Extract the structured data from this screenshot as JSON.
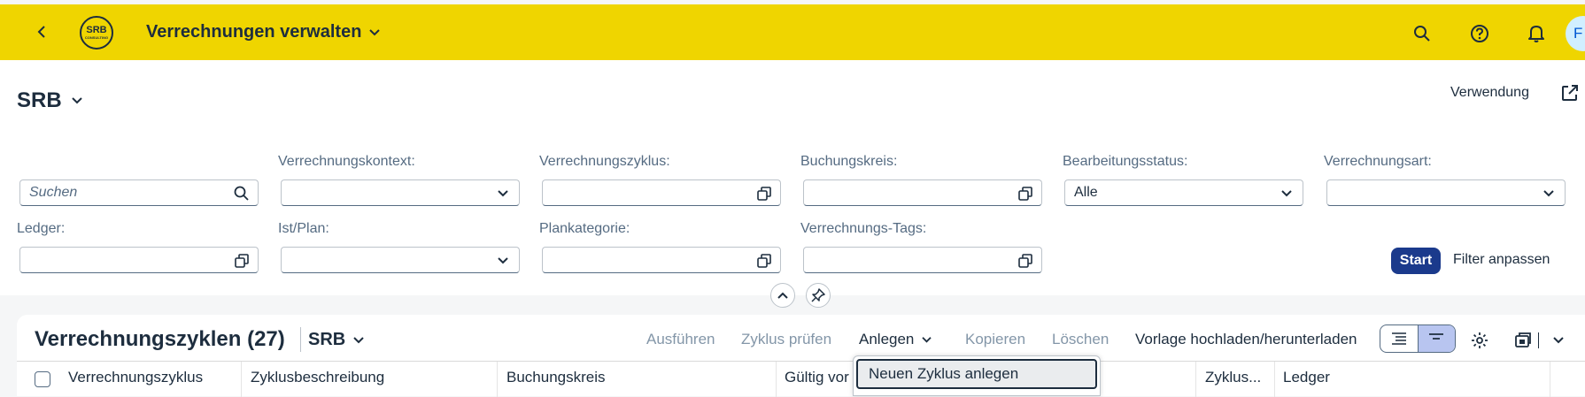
{
  "shell": {
    "title": "Verrechnungen verwalten",
    "logo_text": "SRB",
    "logo_subtext": "CONSULTING",
    "avatar_initial": "F",
    "brand_color": "#efd500"
  },
  "header": {
    "variant": "SRB",
    "verwendung_label": "Verwendung"
  },
  "filters": {
    "search": {
      "placeholder": "Suchen"
    },
    "verrechnungskontext": {
      "label": "Verrechnungskontext:",
      "value": ""
    },
    "verrechnungszyklus": {
      "label": "Verrechnungszyklus:",
      "value": ""
    },
    "buchungskreis": {
      "label": "Buchungskreis:",
      "value": ""
    },
    "bearbeitungsstatus": {
      "label": "Bearbeitungsstatus:",
      "value": "Alle"
    },
    "verrechnungsart": {
      "label": "Verrechnungsart:",
      "value": ""
    },
    "ledger": {
      "label": "Ledger:",
      "value": ""
    },
    "ist_plan": {
      "label": "Ist/Plan:",
      "value": ""
    },
    "plankategorie": {
      "label": "Plankategorie:",
      "value": ""
    },
    "verrechnungs_tags": {
      "label": "Verrechnungs-Tags:",
      "value": ""
    },
    "start_label": "Start",
    "filter_anpassen_label": "Filter anpassen"
  },
  "table": {
    "title": "Verrechnungszyklen (27)",
    "variant": "SRB",
    "toolbar": {
      "ausfuehren": "Ausführen",
      "zyklus_pruefen": "Zyklus prüfen",
      "anlegen": "Anlegen",
      "kopieren": "Kopieren",
      "loeschen": "Löschen",
      "vorlage": "Vorlage hochladen/herunterladen"
    },
    "columns": [
      "Verrechnungszyklus",
      "Zyklusbeschreibung",
      "Buchungskreis",
      "Gültig vor",
      "Zyklus...",
      "Ledger"
    ],
    "anlegen_menu": [
      "Neuen Zyklus anlegen"
    ]
  }
}
